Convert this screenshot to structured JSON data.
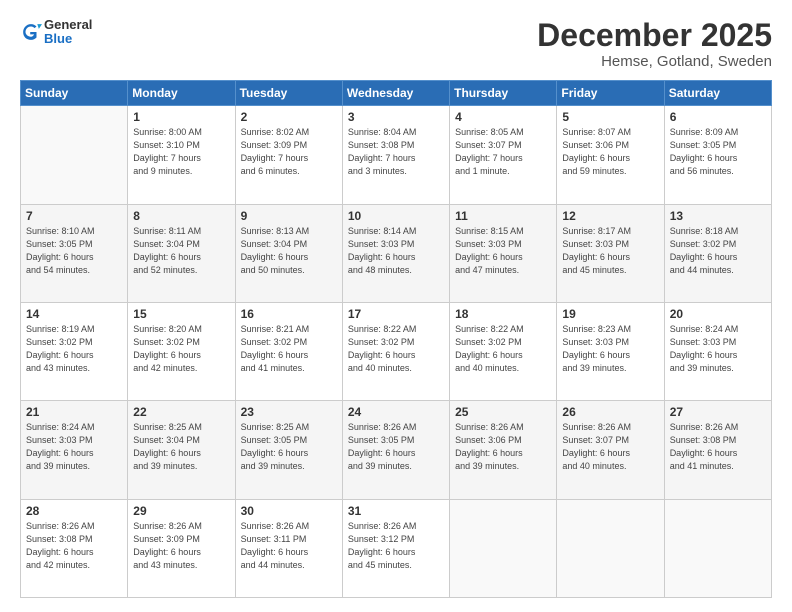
{
  "header": {
    "logo_general": "General",
    "logo_blue": "Blue",
    "month": "December 2025",
    "location": "Hemse, Gotland, Sweden"
  },
  "days_of_week": [
    "Sunday",
    "Monday",
    "Tuesday",
    "Wednesday",
    "Thursday",
    "Friday",
    "Saturday"
  ],
  "weeks": [
    [
      {
        "num": "",
        "detail": ""
      },
      {
        "num": "1",
        "detail": "Sunrise: 8:00 AM\nSunset: 3:10 PM\nDaylight: 7 hours\nand 9 minutes."
      },
      {
        "num": "2",
        "detail": "Sunrise: 8:02 AM\nSunset: 3:09 PM\nDaylight: 7 hours\nand 6 minutes."
      },
      {
        "num": "3",
        "detail": "Sunrise: 8:04 AM\nSunset: 3:08 PM\nDaylight: 7 hours\nand 3 minutes."
      },
      {
        "num": "4",
        "detail": "Sunrise: 8:05 AM\nSunset: 3:07 PM\nDaylight: 7 hours\nand 1 minute."
      },
      {
        "num": "5",
        "detail": "Sunrise: 8:07 AM\nSunset: 3:06 PM\nDaylight: 6 hours\nand 59 minutes."
      },
      {
        "num": "6",
        "detail": "Sunrise: 8:09 AM\nSunset: 3:05 PM\nDaylight: 6 hours\nand 56 minutes."
      }
    ],
    [
      {
        "num": "7",
        "detail": "Sunrise: 8:10 AM\nSunset: 3:05 PM\nDaylight: 6 hours\nand 54 minutes."
      },
      {
        "num": "8",
        "detail": "Sunrise: 8:11 AM\nSunset: 3:04 PM\nDaylight: 6 hours\nand 52 minutes."
      },
      {
        "num": "9",
        "detail": "Sunrise: 8:13 AM\nSunset: 3:04 PM\nDaylight: 6 hours\nand 50 minutes."
      },
      {
        "num": "10",
        "detail": "Sunrise: 8:14 AM\nSunset: 3:03 PM\nDaylight: 6 hours\nand 48 minutes."
      },
      {
        "num": "11",
        "detail": "Sunrise: 8:15 AM\nSunset: 3:03 PM\nDaylight: 6 hours\nand 47 minutes."
      },
      {
        "num": "12",
        "detail": "Sunrise: 8:17 AM\nSunset: 3:03 PM\nDaylight: 6 hours\nand 45 minutes."
      },
      {
        "num": "13",
        "detail": "Sunrise: 8:18 AM\nSunset: 3:02 PM\nDaylight: 6 hours\nand 44 minutes."
      }
    ],
    [
      {
        "num": "14",
        "detail": "Sunrise: 8:19 AM\nSunset: 3:02 PM\nDaylight: 6 hours\nand 43 minutes."
      },
      {
        "num": "15",
        "detail": "Sunrise: 8:20 AM\nSunset: 3:02 PM\nDaylight: 6 hours\nand 42 minutes."
      },
      {
        "num": "16",
        "detail": "Sunrise: 8:21 AM\nSunset: 3:02 PM\nDaylight: 6 hours\nand 41 minutes."
      },
      {
        "num": "17",
        "detail": "Sunrise: 8:22 AM\nSunset: 3:02 PM\nDaylight: 6 hours\nand 40 minutes."
      },
      {
        "num": "18",
        "detail": "Sunrise: 8:22 AM\nSunset: 3:02 PM\nDaylight: 6 hours\nand 40 minutes."
      },
      {
        "num": "19",
        "detail": "Sunrise: 8:23 AM\nSunset: 3:03 PM\nDaylight: 6 hours\nand 39 minutes."
      },
      {
        "num": "20",
        "detail": "Sunrise: 8:24 AM\nSunset: 3:03 PM\nDaylight: 6 hours\nand 39 minutes."
      }
    ],
    [
      {
        "num": "21",
        "detail": "Sunrise: 8:24 AM\nSunset: 3:03 PM\nDaylight: 6 hours\nand 39 minutes."
      },
      {
        "num": "22",
        "detail": "Sunrise: 8:25 AM\nSunset: 3:04 PM\nDaylight: 6 hours\nand 39 minutes."
      },
      {
        "num": "23",
        "detail": "Sunrise: 8:25 AM\nSunset: 3:05 PM\nDaylight: 6 hours\nand 39 minutes."
      },
      {
        "num": "24",
        "detail": "Sunrise: 8:26 AM\nSunset: 3:05 PM\nDaylight: 6 hours\nand 39 minutes."
      },
      {
        "num": "25",
        "detail": "Sunrise: 8:26 AM\nSunset: 3:06 PM\nDaylight: 6 hours\nand 39 minutes."
      },
      {
        "num": "26",
        "detail": "Sunrise: 8:26 AM\nSunset: 3:07 PM\nDaylight: 6 hours\nand 40 minutes."
      },
      {
        "num": "27",
        "detail": "Sunrise: 8:26 AM\nSunset: 3:08 PM\nDaylight: 6 hours\nand 41 minutes."
      }
    ],
    [
      {
        "num": "28",
        "detail": "Sunrise: 8:26 AM\nSunset: 3:08 PM\nDaylight: 6 hours\nand 42 minutes."
      },
      {
        "num": "29",
        "detail": "Sunrise: 8:26 AM\nSunset: 3:09 PM\nDaylight: 6 hours\nand 43 minutes."
      },
      {
        "num": "30",
        "detail": "Sunrise: 8:26 AM\nSunset: 3:11 PM\nDaylight: 6 hours\nand 44 minutes."
      },
      {
        "num": "31",
        "detail": "Sunrise: 8:26 AM\nSunset: 3:12 PM\nDaylight: 6 hours\nand 45 minutes."
      },
      {
        "num": "",
        "detail": ""
      },
      {
        "num": "",
        "detail": ""
      },
      {
        "num": "",
        "detail": ""
      }
    ]
  ]
}
